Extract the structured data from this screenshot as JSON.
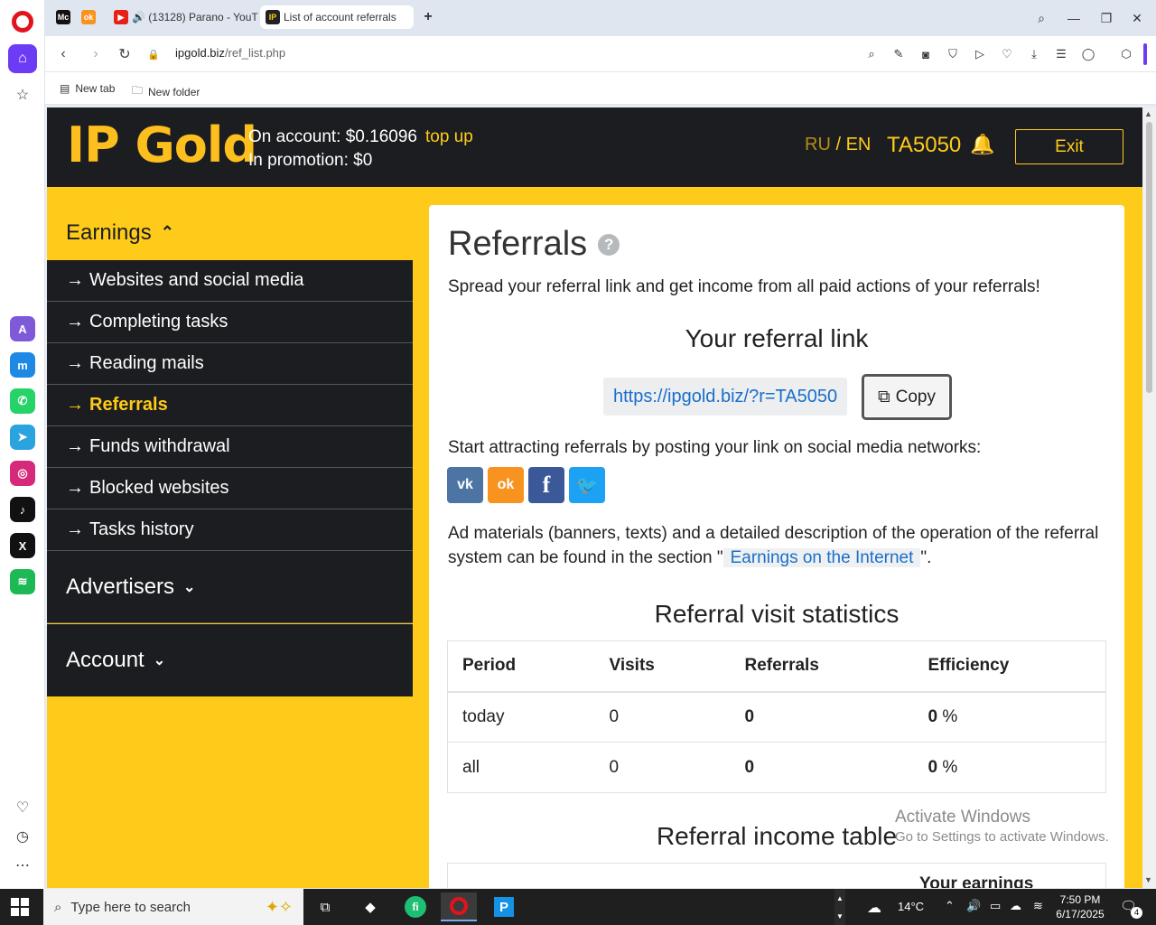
{
  "browser": {
    "tabs": [
      {
        "favicon": "Mc",
        "label": "",
        "fav_color": "#111111"
      },
      {
        "favicon": "ok",
        "label": "",
        "fav_color": "#f7931e"
      },
      {
        "favicon": "▶",
        "label": "🔊 (13128) Parano - YouT",
        "fav_color": "#e62117"
      },
      {
        "favicon": "IP",
        "label": "List of account referrals",
        "fav_color": "#222222"
      }
    ],
    "new_tab_symbol": "+",
    "url_domain": "ipgold.biz",
    "url_path": "/ref_list.php",
    "bookmarks": [
      {
        "label": "New tab",
        "icon": "page-icon"
      },
      {
        "label": "New folder",
        "icon": "folder-icon"
      }
    ]
  },
  "header": {
    "logo": "IP Gold",
    "on_account": "On account: $0.16096",
    "top_up": "top up",
    "in_promotion": "In promotion: $0",
    "lang_ru": "RU",
    "lang_sep": " / ",
    "lang_en": "EN",
    "user_id": "TA5050",
    "exit": "Exit"
  },
  "menu": {
    "earnings": "Earnings",
    "items": [
      {
        "label": "Websites and social media",
        "active": false
      },
      {
        "label": "Completing tasks",
        "active": false
      },
      {
        "label": "Reading mails",
        "active": false
      },
      {
        "label": "Referrals",
        "active": true
      },
      {
        "label": "Funds withdrawal",
        "active": false
      },
      {
        "label": "Blocked websites",
        "active": false
      },
      {
        "label": "Tasks history",
        "active": false
      }
    ],
    "advertisers": "Advertisers",
    "account": "Account"
  },
  "content": {
    "title": "Referrals",
    "intro": "Spread your referral link and get income from all paid actions of your referrals!",
    "link_heading": "Your referral link",
    "ref_link": "https://ipgold.biz/?r=TA5050",
    "copy": "Copy",
    "social_text": "Start attracting referrals by posting your link on social media networks:",
    "social": [
      {
        "name": "vk",
        "glyph": "vk",
        "color": "#4c75a3"
      },
      {
        "name": "odnoklassniki",
        "glyph": "ok",
        "color": "#f7931e"
      },
      {
        "name": "facebook",
        "glyph": "f",
        "color": "#3b5998"
      },
      {
        "name": "twitter",
        "glyph": "🐦",
        "color": "#1da1f2"
      }
    ],
    "ad_text_1": "Ad materials (banners, texts) and a detailed description of the operation of the referral",
    "ad_text_2a": "system can be found in the section \"",
    "ad_link": "Earnings on the Internet",
    "ad_text_2b": "\".",
    "stats_heading": "Referral visit statistics",
    "stats": {
      "columns": [
        "Period",
        "Visits",
        "Referrals",
        "Efficiency"
      ],
      "rows": [
        {
          "period": "today",
          "visits": "0",
          "referrals": "0",
          "efficiency": "0",
          "unit": "%"
        },
        {
          "period": "all",
          "visits": "0",
          "referrals": "0",
          "efficiency": "0",
          "unit": "%"
        }
      ]
    },
    "income_heading": "Referral income table",
    "income_col_partial": "Your earnings"
  },
  "watermark": {
    "line1": "Activate Windows",
    "line2": "Go to Settings to activate Windows."
  },
  "taskbar": {
    "search_placeholder": "Type here to search",
    "weather": "14°C",
    "time": "7:50 PM",
    "date": "6/17/2025",
    "notifications": "4"
  }
}
